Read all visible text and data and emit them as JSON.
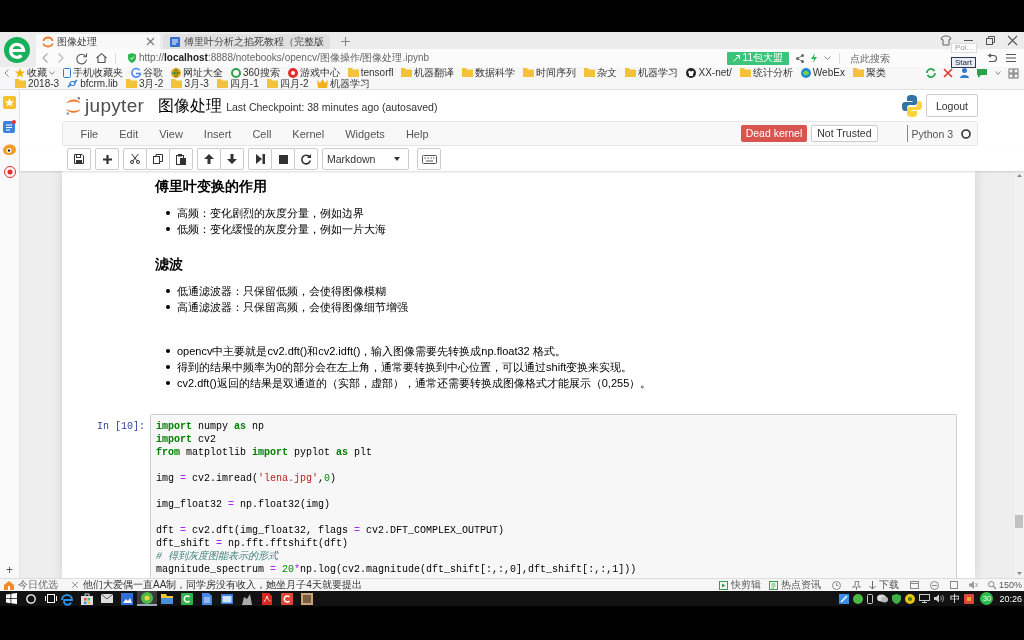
{
  "browser": {
    "tabs": [
      {
        "kind": "jupyter",
        "label": "图像处理",
        "selected": true
      },
      {
        "kind": "page",
        "label": "傅里叶分析之掐死教程（完整版",
        "selected": false
      }
    ],
    "url": "http://**localhost**:8888/notebooks/opencv/图像操作/图像处理.ipynb",
    "promo": "11包大盟",
    "search_placeholder": "点此搜索",
    "tooltip": "Poi...",
    "start_button": "Start",
    "bookmarks": [
      {
        "kind": "favorites",
        "label": "收藏"
      },
      {
        "kind": "mobile",
        "label": "手机收藏夹"
      },
      {
        "kind": "google",
        "label": "谷歌"
      },
      {
        "kind": "globe",
        "label": "网址大全"
      },
      {
        "kind": "search",
        "label": "360搜索"
      },
      {
        "kind": "game",
        "label": "游戏中心"
      },
      {
        "kind": "folder",
        "label": "tensorfl"
      },
      {
        "kind": "folder",
        "label": "机器翻译"
      },
      {
        "kind": "folder",
        "label": "数据科学"
      },
      {
        "kind": "folder",
        "label": "时间序列"
      },
      {
        "kind": "folder",
        "label": "杂文"
      },
      {
        "kind": "folder",
        "label": "机器学习"
      },
      {
        "kind": "github",
        "label": "XX-net/"
      },
      {
        "kind": "folder",
        "label": "统计分析"
      },
      {
        "kind": "webex",
        "label": "WebEx"
      },
      {
        "kind": "folder",
        "label": "聚类"
      },
      {
        "kind": "folder",
        "label": "2018-3"
      },
      {
        "kind": "link",
        "label": "bfcrm.lib"
      },
      {
        "kind": "folder",
        "label": "3月-2"
      },
      {
        "kind": "folder",
        "label": "3月-3"
      },
      {
        "kind": "folder",
        "label": "四月-1"
      },
      {
        "kind": "folder",
        "label": "四月-2"
      },
      {
        "kind": "crown",
        "label": "机器学习"
      }
    ],
    "panel_add": "+"
  },
  "notebook": {
    "logo_text": "jupyter",
    "name": "图像处理",
    "checkpoint": "Last Checkpoint: 38 minutes ago (autosaved)",
    "logout": "Logout",
    "menu": [
      "File",
      "Edit",
      "View",
      "Insert",
      "Cell",
      "Kernel",
      "Widgets",
      "Help"
    ],
    "kernel_status": "Dead kernel",
    "trust": "Not Trusted",
    "kernel_name": "Python 3",
    "kernel_idle": true,
    "cell_type": "Markdown",
    "cells": [
      {
        "kind": "markdown",
        "blocks": [
          {
            "kind": "heading",
            "text": "傅里叶变换的作用"
          },
          {
            "kind": "list",
            "items": [
              "高频：变化剧烈的灰度分量，例如边界",
              "低频：变化缓慢的灰度分量，例如一片大海"
            ]
          },
          {
            "kind": "heading",
            "text": "滤波"
          },
          {
            "kind": "list",
            "items": [
              "低通滤波器：只保留低频，会使得图像模糊",
              "高通滤波器：只保留高频，会使得图像细节增强"
            ]
          },
          {
            "kind": "list",
            "items": [
              "opencv中主要就是cv2.dft()和cv2.idft()，输入图像需要先转换成np.float32 格式。",
              "得到的结果中频率为0的部分会在左上角，通常要转换到中心位置，可以通过shift变换来实现。",
              "cv2.dft()返回的结果是双通道的（实部，虚部），通常还需要转换成图像格式才能展示（0,255）。"
            ]
          }
        ]
      },
      {
        "kind": "code",
        "prompt": "In [10]:",
        "blocks": [
          [
            [
              {
                "kind": "keyword",
                "text": "import"
              },
              {
                "kind": "plain",
                "text": " numpy "
              },
              {
                "kind": "keyword",
                "text": "as"
              },
              {
                "kind": "plain",
                "text": " np"
              }
            ],
            [
              {
                "kind": "keyword",
                "text": "import"
              },
              {
                "kind": "plain",
                "text": " cv2"
              }
            ],
            [
              {
                "kind": "keyword",
                "text": "from"
              },
              {
                "kind": "plain",
                "text": " matplotlib "
              },
              {
                "kind": "keyword",
                "text": "import"
              },
              {
                "kind": "plain",
                "text": " pyplot "
              },
              {
                "kind": "keyword",
                "text": "as"
              },
              {
                "kind": "plain",
                "text": " plt"
              }
            ]
          ],
          [
            [
              {
                "kind": "plain",
                "text": "img "
              },
              {
                "kind": "operator",
                "text": "="
              },
              {
                "kind": "plain",
                "text": " cv2.imread("
              },
              {
                "kind": "string",
                "text": "'lena.jpg'"
              },
              {
                "kind": "plain",
                "text": ","
              },
              {
                "kind": "number",
                "text": "0"
              },
              {
                "kind": "plain",
                "text": ")"
              }
            ]
          ],
          [
            [
              {
                "kind": "plain",
                "text": "img_float32 "
              },
              {
                "kind": "operator",
                "text": "="
              },
              {
                "kind": "plain",
                "text": " np.float32(img)"
              }
            ]
          ],
          [
            [
              {
                "kind": "plain",
                "text": "dft "
              },
              {
                "kind": "operator",
                "text": "="
              },
              {
                "kind": "plain",
                "text": " cv2.dft(img_float32, flags "
              },
              {
                "kind": "operator",
                "text": "="
              },
              {
                "kind": "plain",
                "text": " cv2.DFT_COMPLEX_OUTPUT)"
              }
            ],
            [
              {
                "kind": "plain",
                "text": "dft_shift "
              },
              {
                "kind": "operator",
                "text": "="
              },
              {
                "kind": "plain",
                "text": " np.fft.fftshift(dft)"
              }
            ],
            [
              {
                "kind": "comment",
                "text": "# 得到灰度图能表示的形式"
              }
            ],
            [
              {
                "kind": "plain",
                "text": "magnitude_spectrum "
              },
              {
                "kind": "operator",
                "text": "="
              },
              {
                "kind": "number",
                "text": " 20"
              },
              {
                "kind": "operator",
                "text": "*"
              },
              {
                "kind": "plain",
                "text": "np.log(cv2.magnitude(dft_shift[:,:,0],dft_shift[:,:,1]))"
              }
            ]
          ]
        ]
      }
    ]
  },
  "status_bar": {
    "today": "今日优选",
    "news": "他们大爱偶一直AA制，同学房没有收入，她坐月子4天就要提出",
    "clip": "快剪辑",
    "hot_news": "热点资讯",
    "download": "下载",
    "zoom": "150%"
  },
  "taskbar": {
    "apps": [
      {
        "kind": "edge",
        "selected": false
      },
      {
        "kind": "store",
        "selected": false
      },
      {
        "kind": "mail",
        "selected": false
      },
      {
        "kind": "photos",
        "selected": false
      },
      {
        "kind": "browser",
        "selected": true
      },
      {
        "kind": "explorer",
        "selected": false
      },
      {
        "kind": "greenapp",
        "selected": false
      },
      {
        "kind": "document",
        "selected": false
      },
      {
        "kind": "screen",
        "selected": false
      },
      {
        "kind": "grayapp",
        "selected": false
      },
      {
        "kind": "pdf",
        "selected": false
      },
      {
        "kind": "redapp",
        "selected": false
      },
      {
        "kind": "picture",
        "selected": false
      }
    ],
    "ime": "中",
    "badge": "30",
    "time": "20:26"
  }
}
